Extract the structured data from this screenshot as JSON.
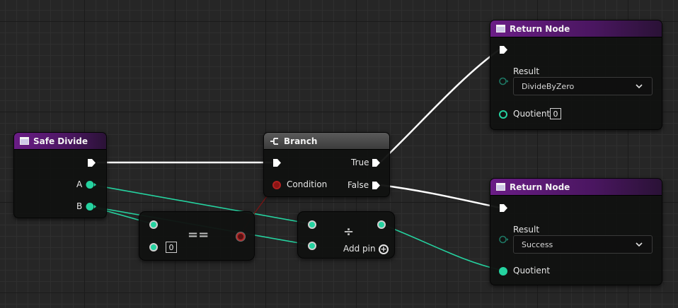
{
  "safe_divide": {
    "title": "Safe Divide",
    "pin_a": "A",
    "pin_b": "B"
  },
  "branch": {
    "title": "Branch",
    "condition": "Condition",
    "true_label": "True",
    "false_label": "False"
  },
  "equals_node": {
    "operator": "==",
    "default_value": "0"
  },
  "divide_node": {
    "operator": "÷",
    "add_pin": "Add pin"
  },
  "return_node_top": {
    "title": "Return Node",
    "result_label": "Result",
    "result_value": "DivideByZero",
    "quotient_label": "Quotient",
    "quotient_value": "0"
  },
  "return_node_bottom": {
    "title": "Return Node",
    "result_label": "Result",
    "result_value": "Success",
    "quotient_label": "Quotient"
  },
  "colors": {
    "exec_wire": "#ffffff",
    "float_wire": "#25d3a0",
    "bool_pin": "#8b1414",
    "function_header": "#6a1d86",
    "branch_header": "#4a4a4a"
  }
}
